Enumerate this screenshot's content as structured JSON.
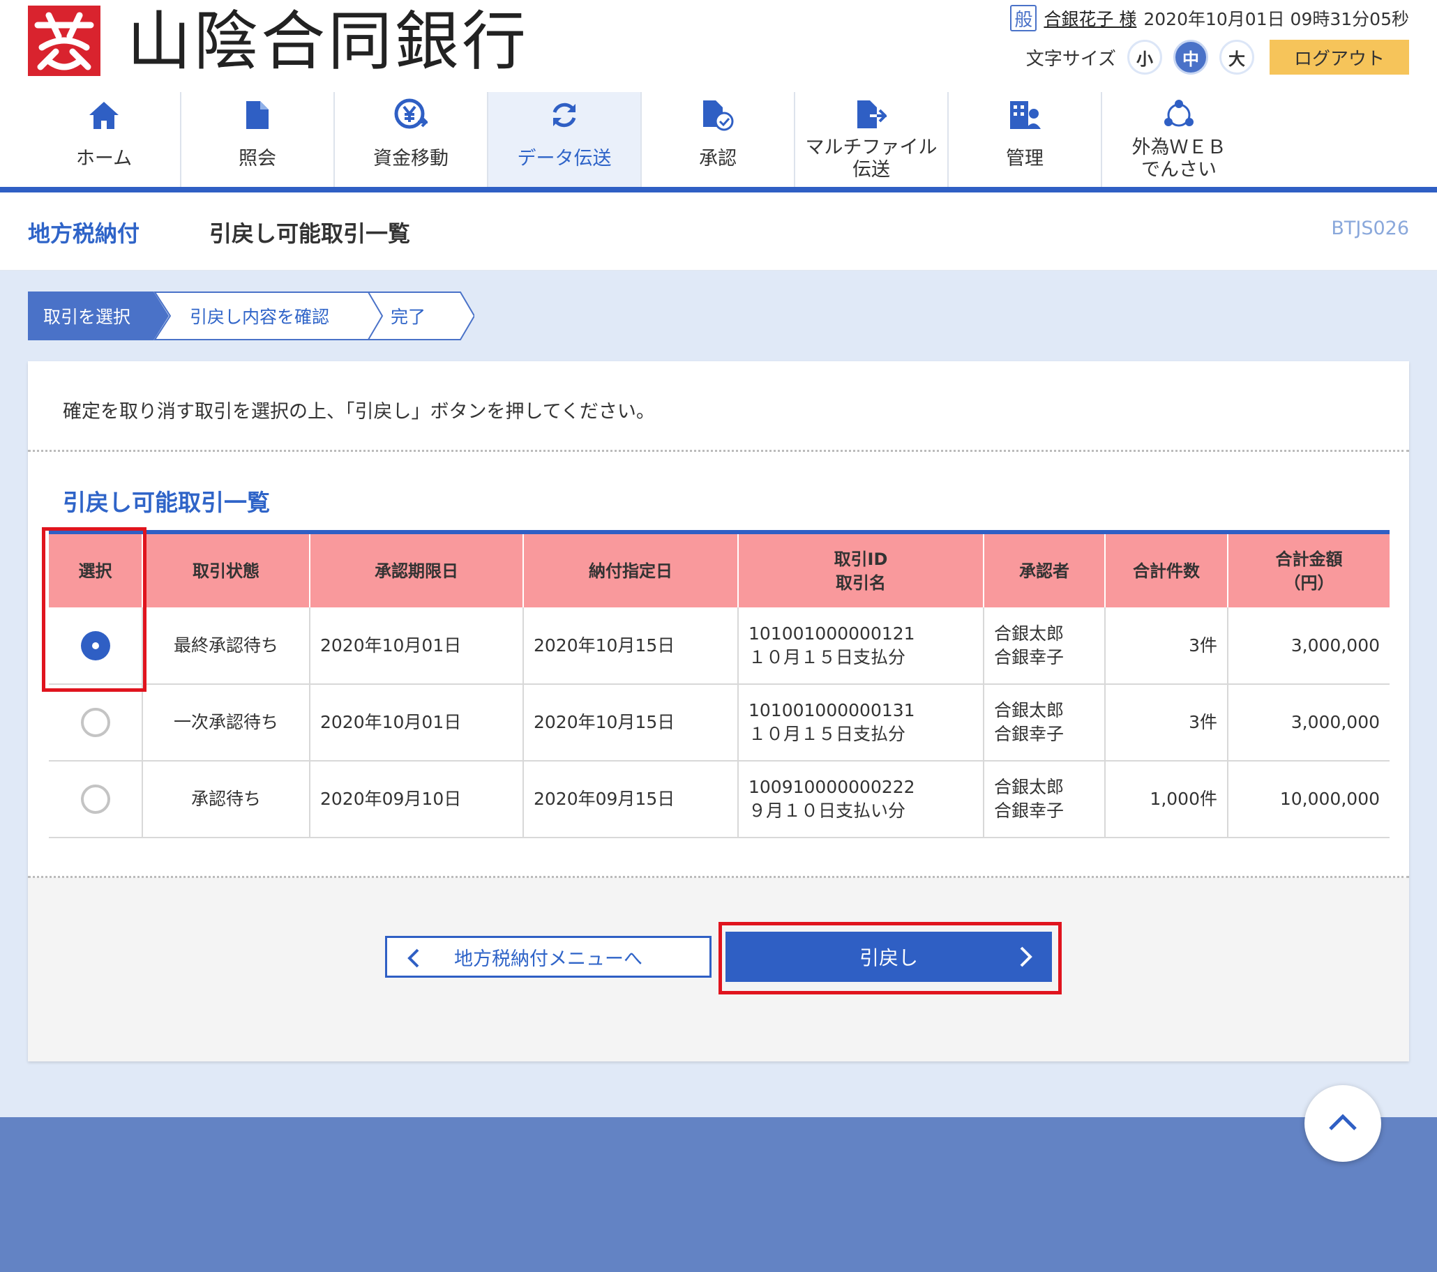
{
  "header": {
    "bank_name": "山陰合同銀行",
    "auth_badge": "般",
    "user_name": "合銀花子 様",
    "datetime": "2020年10月01日 09時31分05秒",
    "font_size_label": "文字サイズ",
    "font_sizes": [
      "小",
      "中",
      "大"
    ],
    "font_size_selected": "中",
    "logout_label": "ログアウト"
  },
  "nav": {
    "items": [
      {
        "label": "ホーム",
        "icon": "home-icon"
      },
      {
        "label": "照会",
        "icon": "document-icon"
      },
      {
        "label": "資金移動",
        "icon": "yen-transfer-icon"
      },
      {
        "label": "データ伝送",
        "icon": "sync-icon"
      },
      {
        "label": "承認",
        "icon": "approve-icon"
      },
      {
        "label": "マルチファイル\n伝送",
        "icon": "file-transfer-icon"
      },
      {
        "label": "管理",
        "icon": "admin-icon"
      },
      {
        "label": "外為ＷＥＢ\nでんさい",
        "icon": "network-icon"
      }
    ],
    "active": "データ伝送"
  },
  "page": {
    "service_name": "地方税納付",
    "title": "引戻し可能取引一覧",
    "screen_id": "BTJS026"
  },
  "steps": [
    "取引を選択",
    "引戻し内容を確認",
    "完了"
  ],
  "content": {
    "instruction": "確定を取り消す取引を選択の上、「引戻し」ボタンを押してください。",
    "section_title": "引戻し可能取引一覧"
  },
  "table": {
    "headers": [
      "選択",
      "取引状態",
      "承認期限日",
      "納付指定日",
      "取引ID\n取引名",
      "承認者",
      "合計件数",
      "合計金額\n（円）"
    ],
    "rows": [
      {
        "selected": true,
        "status": "最終承認待ち",
        "approval_deadline": "2020年10月01日",
        "payment_date": "2020年10月15日",
        "id_name": "101001000000121\n１０月１５日支払分",
        "approvers": "合銀太郎\n合銀幸子",
        "count": "3件",
        "amount": "3,000,000"
      },
      {
        "selected": false,
        "status": "一次承認待ち",
        "approval_deadline": "2020年10月01日",
        "payment_date": "2020年10月15日",
        "id_name": "101001000000131\n１０月１５日支払分",
        "approvers": "合銀太郎\n合銀幸子",
        "count": "3件",
        "amount": "3,000,000"
      },
      {
        "selected": false,
        "status": "承認待ち",
        "approval_deadline": "2020年09月10日",
        "payment_date": "2020年09月15日",
        "id_name": "100910000000222\n９月１０日支払い分",
        "approvers": "合銀太郎\n合銀幸子",
        "count": "1,000件",
        "amount": "10,000,000"
      }
    ]
  },
  "buttons": {
    "back_label": "地方税納付メニューへ",
    "submit_label": "引戻し"
  },
  "colors": {
    "primary": "#2f5fc4",
    "table_header": "#f9999c",
    "highlight": "#e0141e",
    "logout": "#f6c45a",
    "logo": "#d9232e"
  }
}
